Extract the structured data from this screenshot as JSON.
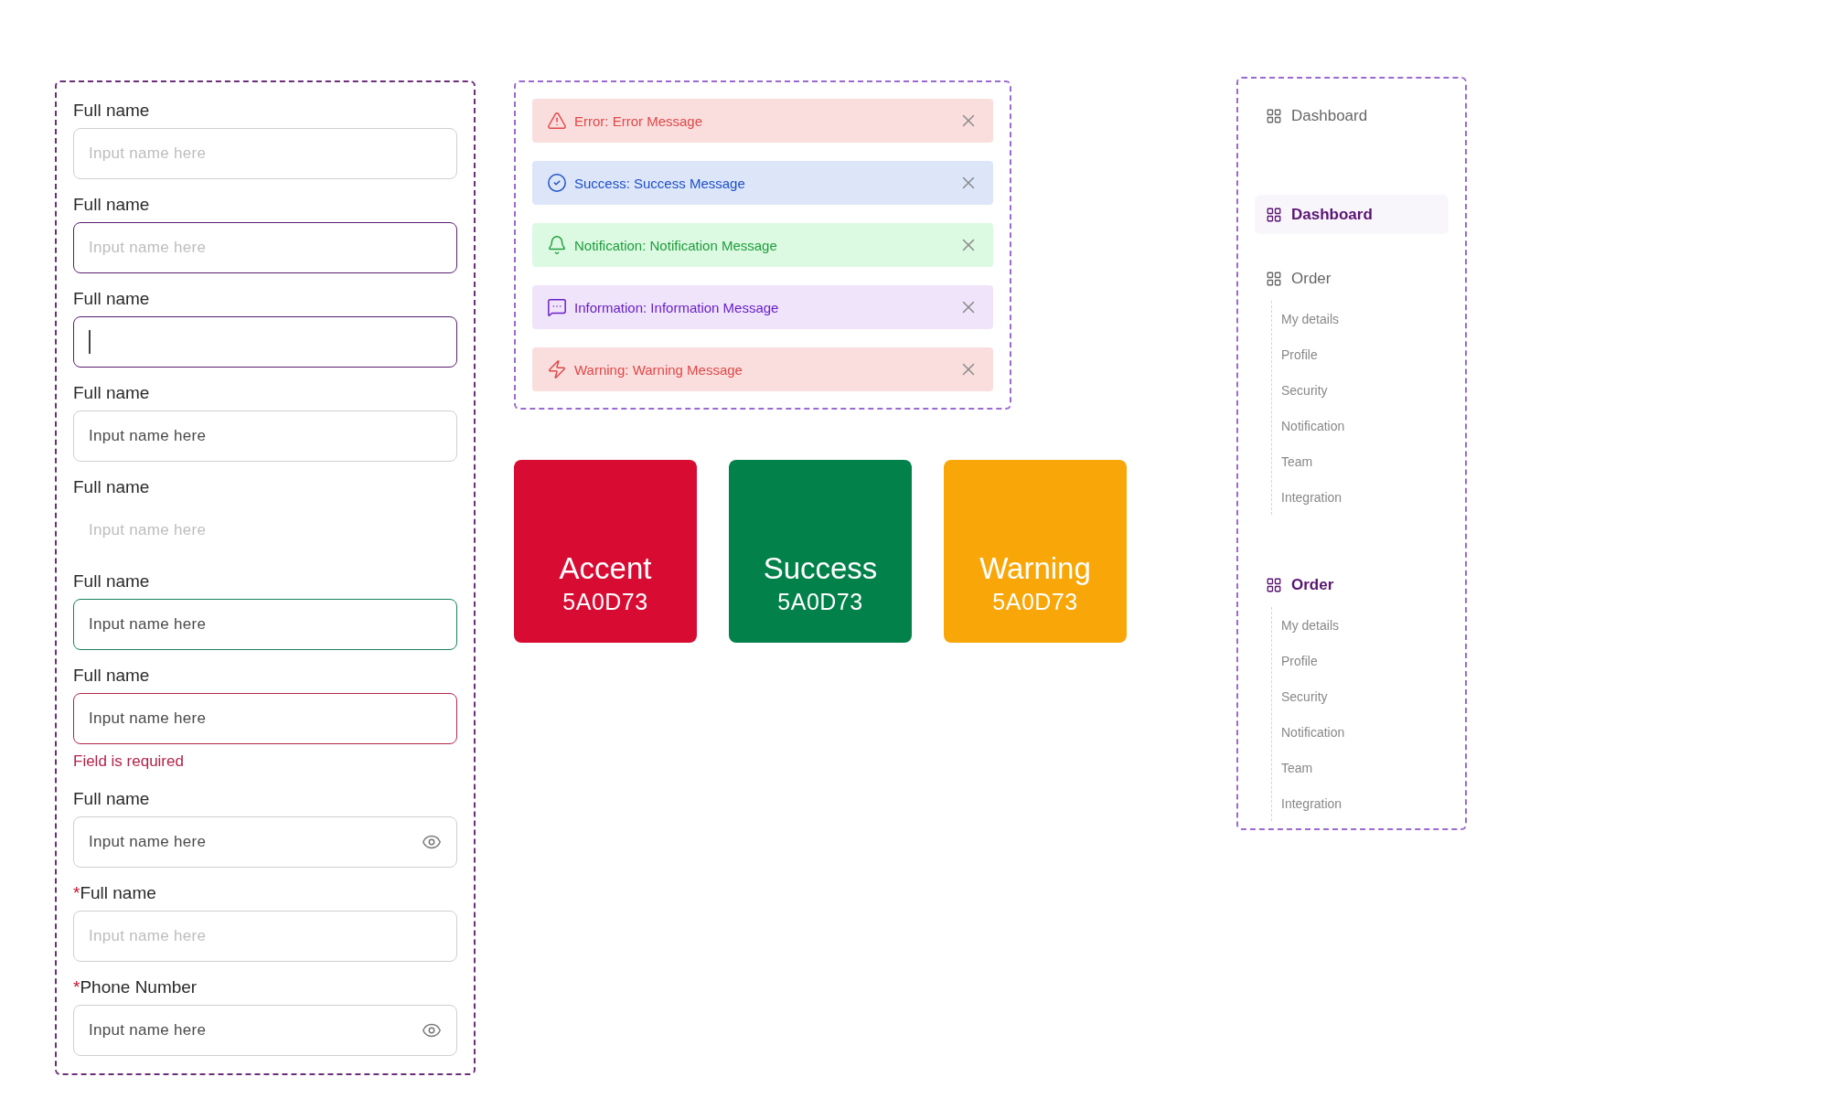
{
  "form_fields": [
    {
      "label": "Full name",
      "placeholder": "Input name here",
      "kind": "default"
    },
    {
      "label": "Full name",
      "placeholder": "Input name here",
      "kind": "hover"
    },
    {
      "label": "Full name",
      "kind": "focused"
    },
    {
      "label": "Full name",
      "value": "Input name here",
      "kind": "default"
    },
    {
      "label": "Full name",
      "placeholder": "Input name here",
      "kind": "borderless"
    },
    {
      "label": "Full name",
      "value": "Input name here",
      "kind": "success"
    },
    {
      "label": "Full name",
      "value": "Input name here",
      "kind": "error",
      "error": "Field is required"
    },
    {
      "label": "Full name",
      "value": "Input name here",
      "kind": "default",
      "eye": true
    },
    {
      "label": "Full name",
      "required_mark": "*",
      "placeholder": "Input name here",
      "kind": "default"
    },
    {
      "label": "Phone Number",
      "required_mark": "*",
      "value": "Input name here",
      "kind": "default",
      "eye": true
    }
  ],
  "alerts": [
    {
      "kind": "error",
      "text": "Error: Error Message"
    },
    {
      "kind": "success",
      "text": "Success: Success Message"
    },
    {
      "kind": "notification",
      "text": "Notification: Notification Message"
    },
    {
      "kind": "information",
      "text": "Information: Information Message"
    },
    {
      "kind": "warning",
      "text": "Warning: Warning Message"
    }
  ],
  "color_cards": [
    {
      "title": "Accent",
      "code": "5A0D73",
      "color": "#d80c33"
    },
    {
      "title": "Success",
      "code": "5A0D73",
      "color": "#03814b"
    },
    {
      "title": "Warning",
      "code": "5A0D73",
      "color": "#f9a708"
    }
  ],
  "sidebar": {
    "items": [
      {
        "label": "Dashboard",
        "selected": false
      },
      {
        "label": "Dashboard",
        "selected": true
      },
      {
        "label": "Order",
        "selected": false,
        "children": [
          {
            "label": "My details"
          },
          {
            "label": "Profile"
          },
          {
            "label": "Security"
          },
          {
            "label": "Notification"
          },
          {
            "label": "Team"
          },
          {
            "label": "Integration"
          }
        ]
      },
      {
        "label": "Order",
        "selected": true,
        "children": [
          {
            "label": "My details"
          },
          {
            "label": "Profile"
          },
          {
            "label": "Security"
          },
          {
            "label": "Notification"
          },
          {
            "label": "Team"
          },
          {
            "label": "Integration"
          }
        ]
      }
    ]
  }
}
